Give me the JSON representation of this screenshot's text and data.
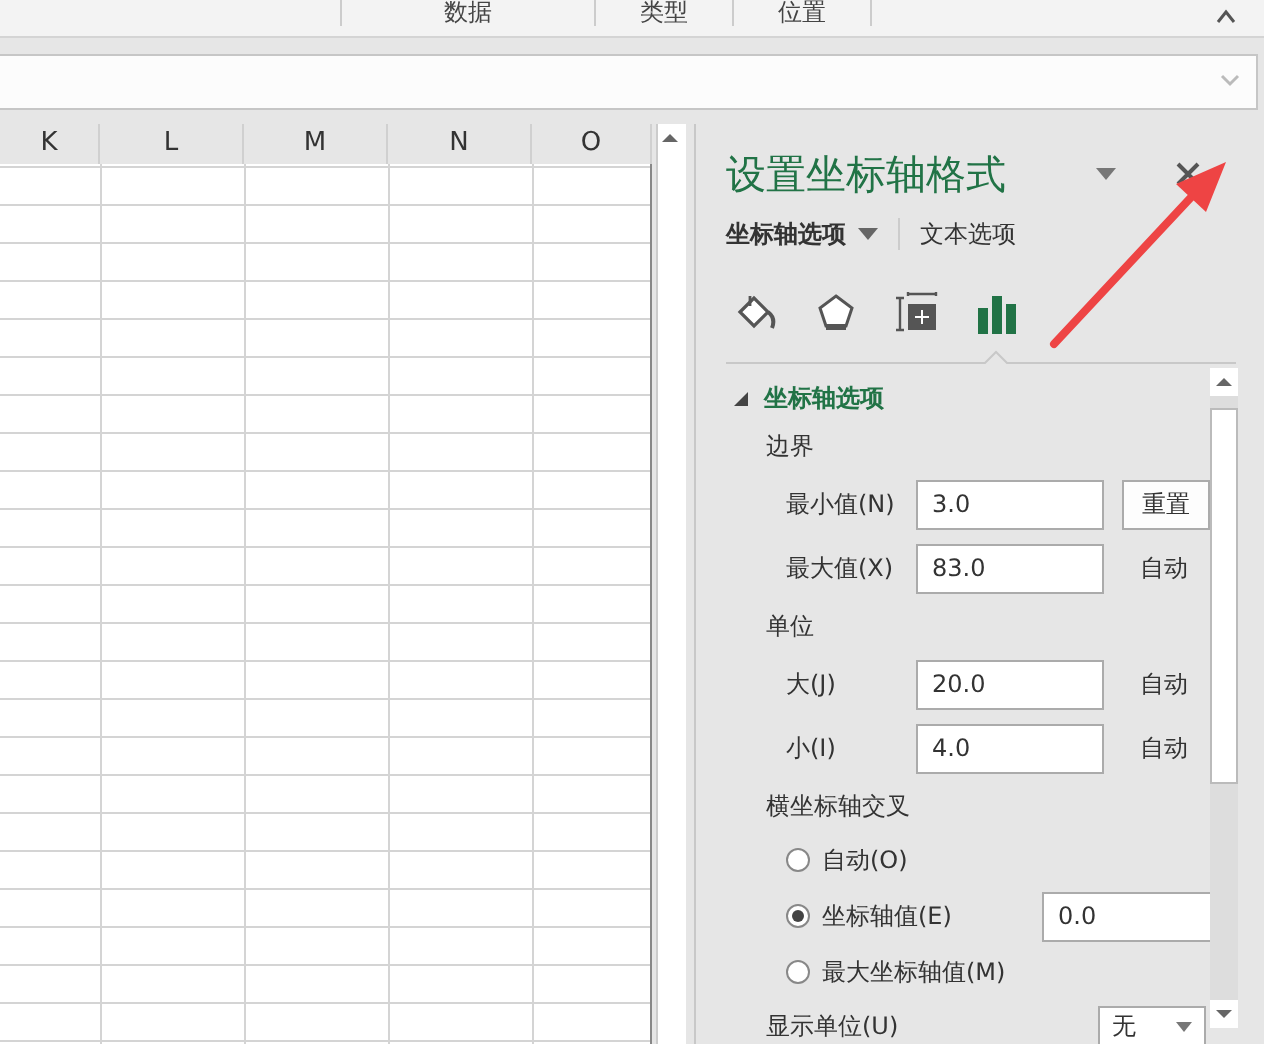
{
  "ribbon": {
    "groups": [
      "数据",
      "类型",
      "位置"
    ]
  },
  "sheet": {
    "columns": [
      "K",
      "L",
      "M",
      "N",
      "O"
    ]
  },
  "pane": {
    "title": "设置坐标轴格式",
    "tabs": [
      {
        "label": "坐标轴选项",
        "selected": true
      },
      {
        "label": "文本选项",
        "selected": false
      }
    ],
    "icon_tabs": [
      {
        "kind": "fill",
        "selected": false
      },
      {
        "kind": "effects",
        "selected": false
      },
      {
        "kind": "size",
        "selected": false
      },
      {
        "kind": "axis",
        "selected": true
      }
    ],
    "section": {
      "title": "坐标轴选项",
      "expanded": true
    },
    "rows": [
      {
        "kind": "heading",
        "label": "边界"
      },
      {
        "kind": "field",
        "label": "最小值(N)",
        "value": "3.0",
        "button": "重置"
      },
      {
        "kind": "field",
        "label": "最大值(X)",
        "value": "83.0",
        "note": "自动"
      },
      {
        "kind": "heading",
        "label": "单位"
      },
      {
        "kind": "field",
        "label": "大(J)",
        "value": "20.0",
        "note": "自动"
      },
      {
        "kind": "field",
        "label": "小(I)",
        "value": "4.0",
        "note": "自动"
      },
      {
        "kind": "heading",
        "label": "横坐标轴交叉"
      },
      {
        "kind": "radio",
        "label": "自动(O)",
        "selected": false
      },
      {
        "kind": "radio",
        "label": "坐标轴值(E)",
        "selected": true,
        "value": "0.0"
      },
      {
        "kind": "radio",
        "label": "最大坐标轴值(M)",
        "selected": false
      },
      {
        "kind": "select",
        "label": "显示单位(U)",
        "value": "无"
      }
    ]
  }
}
